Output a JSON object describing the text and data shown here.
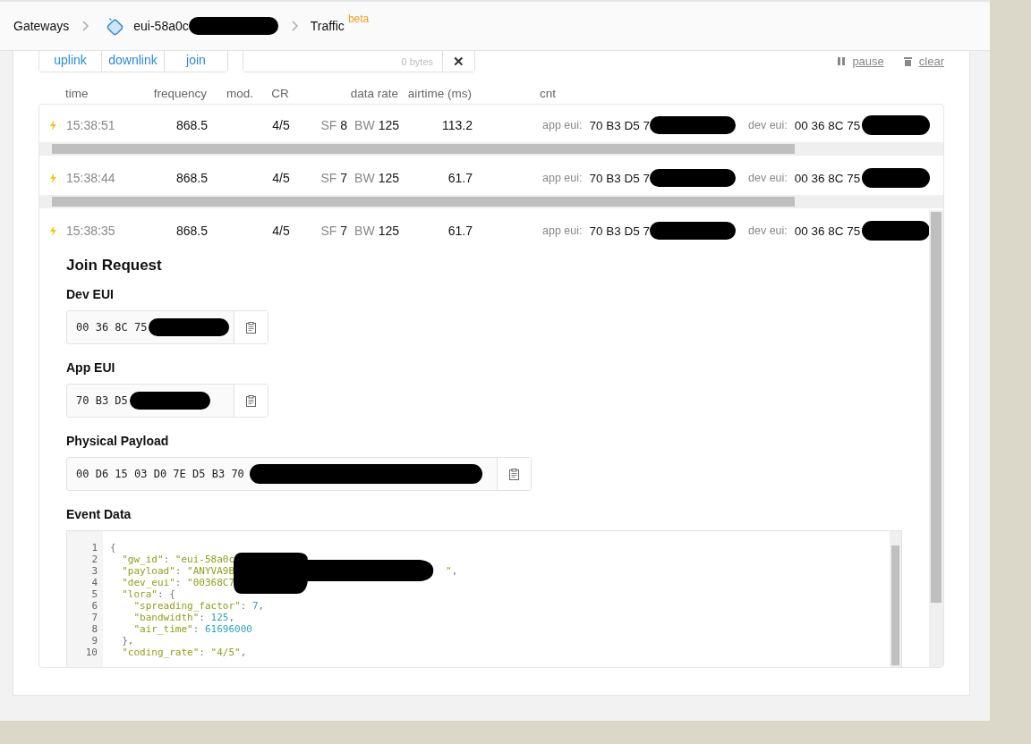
{
  "breadcrumb": {
    "items": [
      {
        "label": "Gateways",
        "kind": "link"
      },
      {
        "label": "eui-58a0c",
        "kind": "gateway",
        "redacted": true
      },
      {
        "label": "Traffic",
        "kind": "current",
        "badge": "beta"
      }
    ]
  },
  "filters": [
    {
      "label": "uplink"
    },
    {
      "label": "downlink"
    },
    {
      "label": "join"
    }
  ],
  "payload_filter": {
    "placeholder": "0 bytes",
    "clear": "✕"
  },
  "actions": [
    {
      "label": "pause",
      "kind": "pause"
    },
    {
      "label": "clear",
      "kind": "trash"
    }
  ],
  "columns": [
    "time",
    "frequency",
    "mod.",
    "CR",
    "data rate",
    "airtime (ms)",
    "cnt"
  ],
  "rows": [
    {
      "time": "15:38:51",
      "frequency": "868.5",
      "cr": "4/5",
      "sf_label": "SF",
      "sf": "8",
      "bw_label": "BW",
      "bw": "125",
      "airtime": "113.2",
      "app_eui_label": "app eui:",
      "app_eui": "70 B3 D5 7",
      "dev_eui_label": "dev eui:",
      "dev_eui": "00 36 8C 75",
      "expanded": false
    },
    {
      "time": "15:38:44",
      "frequency": "868.5",
      "cr": "4/5",
      "sf_label": "SF",
      "sf": "7",
      "bw_label": "BW",
      "bw": "125",
      "airtime": "61.7",
      "app_eui_label": "app eui:",
      "app_eui": "70 B3 D5 7",
      "dev_eui_label": "dev eui:",
      "dev_eui": "00 36 8C 75",
      "expanded": false
    },
    {
      "time": "15:38:35",
      "frequency": "868.5",
      "cr": "4/5",
      "sf_label": "SF",
      "sf": "7",
      "bw_label": "BW",
      "bw": "125",
      "airtime": "61.7",
      "app_eui_label": "app eui:",
      "app_eui": "70 B3 D5 7",
      "dev_eui_label": "dev eui:",
      "dev_eui": "00 36 8C 75",
      "expanded": true,
      "detail": {
        "title": "Join Request",
        "fields": [
          {
            "label": "Dev EUI",
            "value": "00 36 8C 75"
          },
          {
            "label": "App EUI",
            "value": "70 B3 D5"
          },
          {
            "label": "Physical Payload",
            "value": "00 D6 15 03 D0 7E D5 B3 70"
          }
        ],
        "event_label": "Event Data",
        "event_redacted": true,
        "code": [
          {
            "number": "1",
            "tokens": [
              {
                "kind": "punct",
                "text": "{"
              }
            ]
          },
          {
            "number": "2",
            "tokens": [
              {
                "kind": "key",
                "text": "  \"gw_id\""
              },
              {
                "kind": "punct",
                "text": ": "
              },
              {
                "kind": "string",
                "text": "\"eui-58a0c"
              }
            ]
          },
          {
            "number": "3",
            "tokens": [
              {
                "kind": "key",
                "text": "  \"payload\""
              },
              {
                "kind": "punct",
                "text": ": "
              },
              {
                "kind": "string",
                "text": "\"ANYVA9B"
              },
              {
                "kind": "string",
                "text": "\""
              },
              {
                "kind": "punct",
                "text": ","
              }
            ]
          },
          {
            "number": "4",
            "tokens": [
              {
                "kind": "key",
                "text": "  \"dev_eui\""
              },
              {
                "kind": "punct",
                "text": ": "
              },
              {
                "kind": "string",
                "text": "\"00368C7"
              }
            ]
          },
          {
            "number": "5",
            "tokens": [
              {
                "kind": "key",
                "text": "  \"lora\""
              },
              {
                "kind": "punct",
                "text": ": {"
              }
            ]
          },
          {
            "number": "6",
            "tokens": [
              {
                "kind": "key",
                "text": "    \"spreading_factor\""
              },
              {
                "kind": "punct",
                "text": ": "
              },
              {
                "kind": "number",
                "text": "7"
              },
              {
                "kind": "punct",
                "text": ","
              }
            ]
          },
          {
            "number": "7",
            "tokens": [
              {
                "kind": "key",
                "text": "    \"bandwidth\""
              },
              {
                "kind": "punct",
                "text": ": "
              },
              {
                "kind": "number",
                "text": "125"
              },
              {
                "kind": "punct",
                "text": ","
              }
            ]
          },
          {
            "number": "8",
            "tokens": [
              {
                "kind": "key",
                "text": "    \"air_time\""
              },
              {
                "kind": "punct",
                "text": ": "
              },
              {
                "kind": "number",
                "text": "61696000"
              }
            ]
          },
          {
            "number": "9",
            "tokens": [
              {
                "kind": "punct",
                "text": "  },"
              }
            ]
          },
          {
            "number": "10",
            "tokens": [
              {
                "kind": "key",
                "text": "  \"coding_rate\""
              },
              {
                "kind": "punct",
                "text": ": "
              },
              {
                "kind": "string",
                "text": "\"4/5\""
              },
              {
                "kind": "punct",
                "text": ","
              }
            ]
          }
        ]
      }
    }
  ]
}
